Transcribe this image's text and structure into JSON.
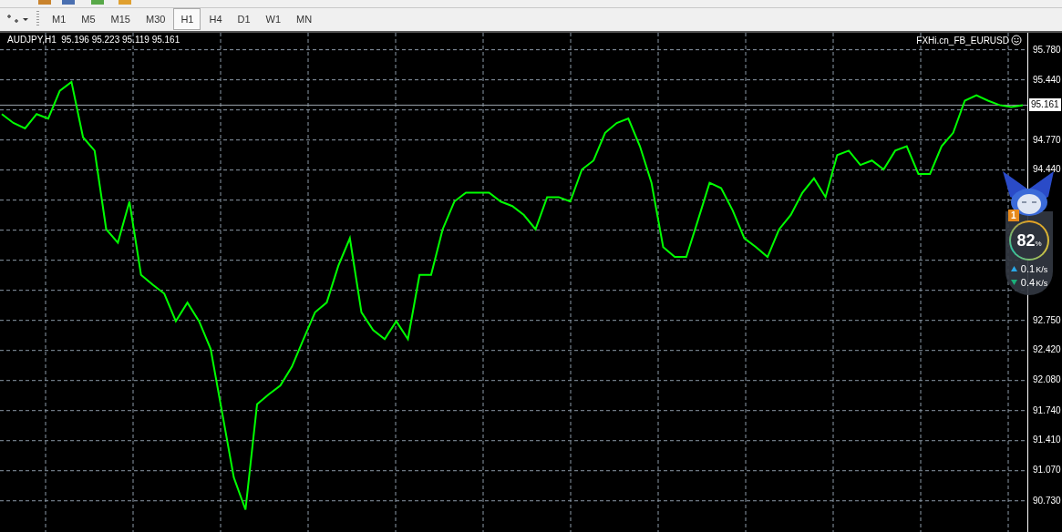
{
  "toolbar": {
    "timeframes": [
      {
        "label": "M1",
        "selected": false
      },
      {
        "label": "M5",
        "selected": false
      },
      {
        "label": "M15",
        "selected": false
      },
      {
        "label": "M30",
        "selected": false
      },
      {
        "label": "H1",
        "selected": true
      },
      {
        "label": "H4",
        "selected": false
      },
      {
        "label": "D1",
        "selected": false
      },
      {
        "label": "W1",
        "selected": false
      },
      {
        "label": "MN",
        "selected": false
      }
    ]
  },
  "chart": {
    "title": "AUDJPY,H1  95.196 95.223 95.119 95.161",
    "expert": "FXHi.cn_FB_EURUSD",
    "price_label": "95.161",
    "chart_data": {
      "type": "line",
      "grid": true,
      "ref_lines": [
        {
          "axis": "y",
          "value": 95.16,
          "color": "#9aa3aa"
        }
      ],
      "ylim": [
        90.38,
        95.97
      ],
      "yticks": [
        {
          "value": 95.78,
          "label": "95.780"
        },
        {
          "value": 95.44,
          "label": "95.440"
        },
        {
          "value": 94.77,
          "label": "94.770"
        },
        {
          "value": 94.44,
          "label": "94.440"
        },
        {
          "value": 92.75,
          "label": "92.750"
        },
        {
          "value": 92.42,
          "label": "92.420"
        },
        {
          "value": 92.08,
          "label": "92.080"
        },
        {
          "value": 91.74,
          "label": "91.740"
        },
        {
          "value": 91.41,
          "label": "91.410"
        },
        {
          "value": 91.07,
          "label": "91.070"
        },
        {
          "value": 90.73,
          "label": "90.730"
        }
      ],
      "series": [
        {
          "color": "#00ff00",
          "values": [
            95.06,
            94.96,
            94.9,
            95.06,
            95.01,
            95.32,
            95.42,
            94.8,
            94.65,
            93.77,
            93.62,
            94.08,
            93.26,
            93.15,
            93.05,
            92.74,
            92.95,
            92.74,
            92.43,
            91.71,
            90.99,
            90.63,
            91.81,
            91.92,
            92.02,
            92.23,
            92.54,
            92.84,
            92.95,
            93.36,
            93.67,
            92.84,
            92.64,
            92.54,
            92.74,
            92.54,
            93.26,
            93.26,
            93.77,
            94.08,
            94.18,
            94.18,
            94.18,
            94.08,
            94.03,
            93.93,
            93.77,
            94.13,
            94.13,
            94.08,
            94.44,
            94.54,
            94.85,
            94.96,
            95.01,
            94.7,
            94.29,
            93.57,
            93.46,
            93.46,
            93.87,
            94.29,
            94.23,
            93.98,
            93.67,
            93.57,
            93.46,
            93.77,
            93.93,
            94.18,
            94.34,
            94.13,
            94.6,
            94.65,
            94.49,
            94.54,
            94.44,
            94.65,
            94.7,
            94.39,
            94.39,
            94.7,
            94.85,
            95.21,
            95.27,
            95.21,
            95.16,
            95.14,
            95.16
          ]
        }
      ]
    }
  },
  "widget": {
    "badge": "1",
    "percent": "82",
    "percent_unit": "%",
    "upload": {
      "value": "0.1",
      "unit": "K/s"
    },
    "download": {
      "value": "0.4",
      "unit": "K/s"
    }
  }
}
